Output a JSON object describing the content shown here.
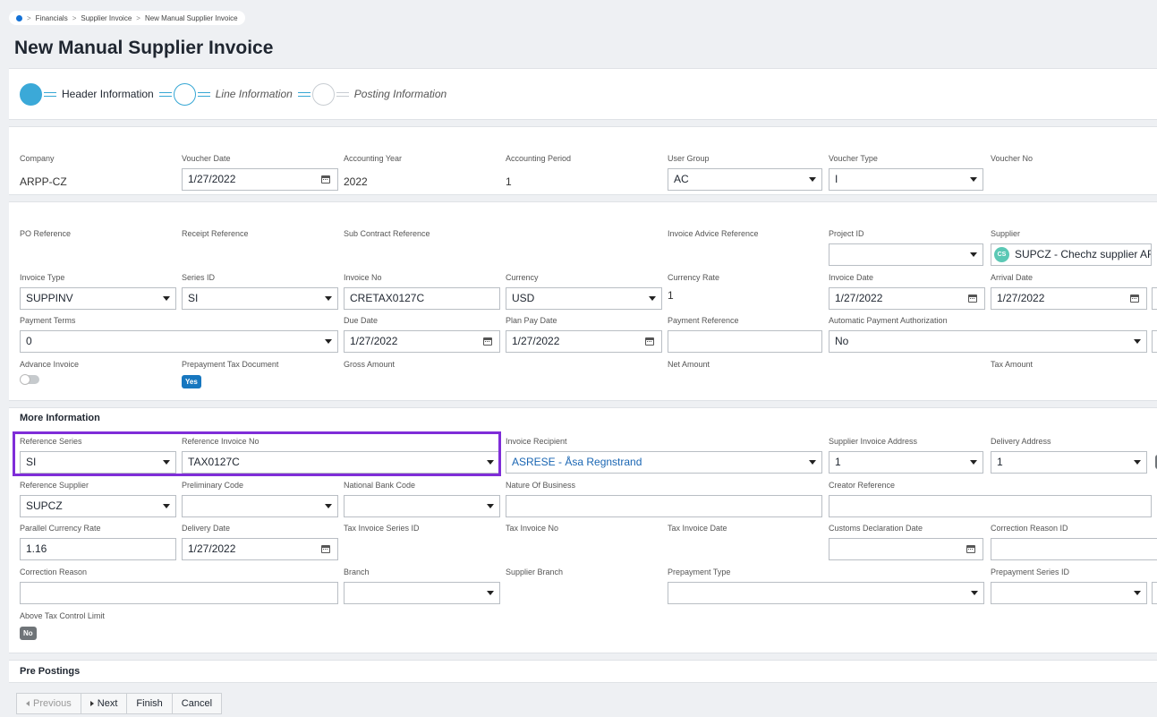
{
  "breadcrumb": {
    "items": [
      "Financials",
      "Supplier Invoice",
      "New Manual Supplier Invoice"
    ]
  },
  "page": {
    "title": "New Manual Supplier Invoice"
  },
  "stepper": {
    "steps": [
      "Header Information",
      "Line Information",
      "Posting Information"
    ]
  },
  "header": {
    "company": {
      "label": "Company",
      "value": "ARPP-CZ"
    },
    "voucher_date": {
      "label": "Voucher Date",
      "value": "1/27/2022"
    },
    "accounting_year": {
      "label": "Accounting Year",
      "value": "2022"
    },
    "accounting_period": {
      "label": "Accounting Period",
      "value": "1"
    },
    "user_group": {
      "label": "User Group",
      "value": "AC"
    },
    "voucher_type": {
      "label": "Voucher Type",
      "value": "I"
    },
    "voucher_no": {
      "label": "Voucher No",
      "value": ""
    }
  },
  "general": {
    "po_reference": {
      "label": "PO Reference"
    },
    "receipt_reference": {
      "label": "Receipt Reference"
    },
    "sub_contract_reference": {
      "label": "Sub Contract Reference"
    },
    "invoice_advice_reference": {
      "label": "Invoice Advice Reference"
    },
    "project_id": {
      "label": "Project ID",
      "value": ""
    },
    "supplier": {
      "label": "Supplier",
      "value": "SUPCZ - Chechz supplier AR",
      "avatar": "CS"
    },
    "invoice_type": {
      "label": "Invoice Type",
      "value": "SUPPINV"
    },
    "series_id": {
      "label": "Series ID",
      "value": "SI"
    },
    "invoice_no": {
      "label": "Invoice No",
      "value": "CRETAX0127C"
    },
    "currency": {
      "label": "Currency",
      "value": "USD"
    },
    "currency_rate": {
      "label": "Currency Rate",
      "value": "1"
    },
    "invoice_date": {
      "label": "Invoice Date",
      "value": "1/27/2022"
    },
    "arrival_date": {
      "label": "Arrival Date",
      "value": "1/27/2022"
    },
    "payment_terms": {
      "label": "Payment Terms",
      "value": "0"
    },
    "due_date": {
      "label": "Due Date",
      "value": "1/27/2022"
    },
    "plan_pay_date": {
      "label": "Plan Pay Date",
      "value": "1/27/2022"
    },
    "payment_reference": {
      "label": "Payment Reference",
      "value": ""
    },
    "auto_payment_auth": {
      "label": "Automatic Payment Authorization",
      "value": "No"
    },
    "advance_invoice": {
      "label": "Advance Invoice"
    },
    "prepayment_tax_document": {
      "label": "Prepayment Tax Document",
      "value": "Yes"
    },
    "gross_amount": {
      "label": "Gross Amount"
    },
    "net_amount": {
      "label": "Net Amount"
    },
    "tax_amount": {
      "label": "Tax Amount"
    }
  },
  "more_info": {
    "title": "More Information",
    "reference_series": {
      "label": "Reference Series",
      "value": "SI"
    },
    "reference_invoice_no": {
      "label": "Reference Invoice No",
      "value": "TAX0127C"
    },
    "invoice_recipient": {
      "label": "Invoice Recipient",
      "value": "ASRESE - Åsa Regnstrand"
    },
    "supplier_invoice_address": {
      "label": "Supplier Invoice Address",
      "value": "1"
    },
    "delivery_address": {
      "label": "Delivery Address",
      "value": "1"
    },
    "reference_supplier": {
      "label": "Reference Supplier",
      "value": "SUPCZ"
    },
    "preliminary_code": {
      "label": "Preliminary Code",
      "value": ""
    },
    "national_bank_code": {
      "label": "National Bank Code",
      "value": ""
    },
    "nature_of_business": {
      "label": "Nature Of Business",
      "value": ""
    },
    "creator_reference": {
      "label": "Creator Reference",
      "value": ""
    },
    "parallel_currency_rate": {
      "label": "Parallel Currency Rate",
      "value": "1.16"
    },
    "delivery_date": {
      "label": "Delivery Date",
      "value": "1/27/2022"
    },
    "tax_invoice_series_id": {
      "label": "Tax Invoice Series ID"
    },
    "tax_invoice_no": {
      "label": "Tax Invoice No"
    },
    "tax_invoice_date": {
      "label": "Tax Invoice Date"
    },
    "customs_declaration_date": {
      "label": "Customs Declaration Date",
      "value": ""
    },
    "correction_reason_id": {
      "label": "Correction Reason ID",
      "value": ""
    },
    "correction_reason": {
      "label": "Correction Reason",
      "value": ""
    },
    "branch": {
      "label": "Branch",
      "value": ""
    },
    "supplier_branch": {
      "label": "Supplier Branch"
    },
    "prepayment_type": {
      "label": "Prepayment Type",
      "value": ""
    },
    "prepayment_series_id": {
      "label": "Prepayment Series ID",
      "value": ""
    },
    "above_tax_control_limit": {
      "label": "Above Tax Control Limit",
      "value": "No"
    }
  },
  "pre_postings": {
    "title": "Pre Postings"
  },
  "footer": {
    "previous": "Previous",
    "next": "Next",
    "finish": "Finish",
    "cancel": "Cancel"
  },
  "colors": {
    "accent": "#3ba9d8",
    "highlight": "#7f2dd8",
    "link": "#1a66b3",
    "badge_yes": "#1777bf",
    "badge_no": "#6f7478"
  }
}
